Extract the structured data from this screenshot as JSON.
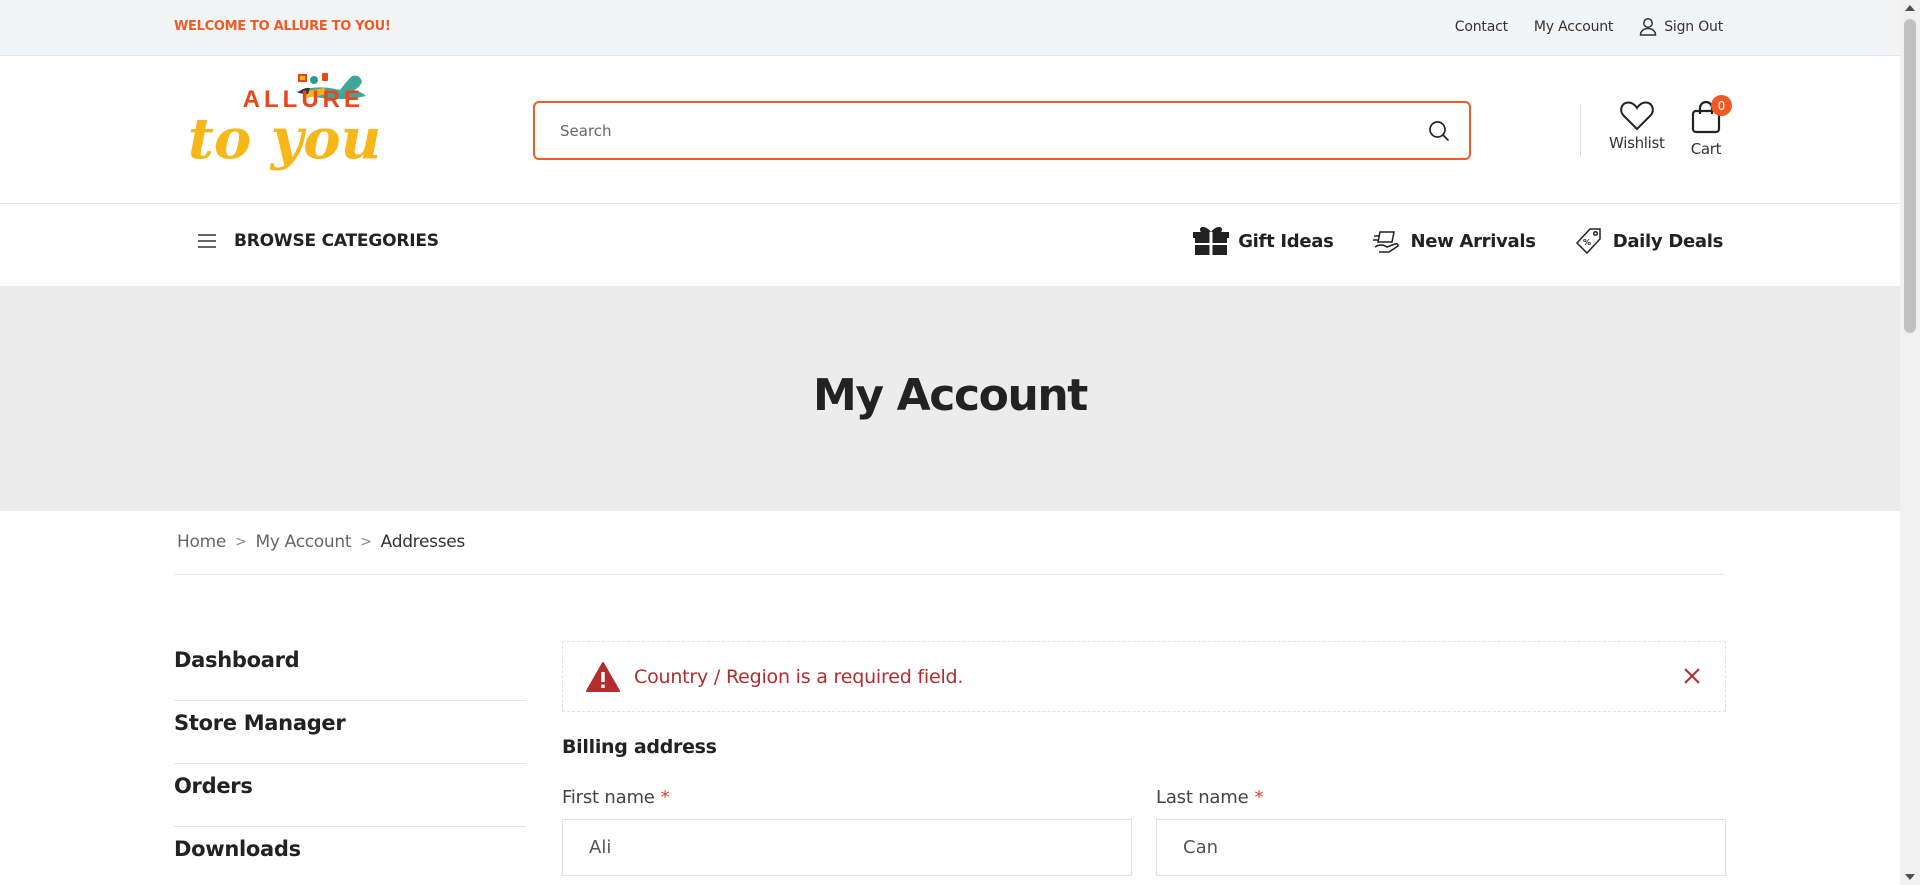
{
  "topbar": {
    "welcome": "WELCOME TO ALLURE TO YOU!",
    "links": {
      "contact": "Contact",
      "my_account": "My Account",
      "sign_out": "Sign Out"
    }
  },
  "header": {
    "logo": {
      "line1": "ALLURE",
      "line2": "to you"
    },
    "search": {
      "placeholder": "Search",
      "value": ""
    },
    "wishlist_label": "Wishlist",
    "cart_label": "Cart",
    "cart_count": "0"
  },
  "nav": {
    "browse": "BROWSE CATEGORIES",
    "gift_ideas": "Gift Ideas",
    "new_arrivals": "New Arrivals",
    "daily_deals": "Daily Deals"
  },
  "hero": {
    "title": "My Account"
  },
  "breadcrumb": {
    "home": "Home",
    "my_account": "My Account",
    "current": "Addresses",
    "separator": ">"
  },
  "sidebar": {
    "items": [
      "Dashboard",
      "Store Manager",
      "Orders",
      "Downloads"
    ]
  },
  "main": {
    "alert_message": "Country / Region is a required field.",
    "billing_heading": "Billing address",
    "first_name": {
      "label": "First name",
      "required": "*",
      "value": "Ali"
    },
    "last_name": {
      "label": "Last name",
      "required": "*",
      "value": "Can"
    }
  },
  "colors": {
    "accent": "#f15a24",
    "logo_yellow": "#f7b718",
    "error": "#b32d2e",
    "hero_bg": "#ececec",
    "topbar_bg": "#f3f4f6"
  }
}
